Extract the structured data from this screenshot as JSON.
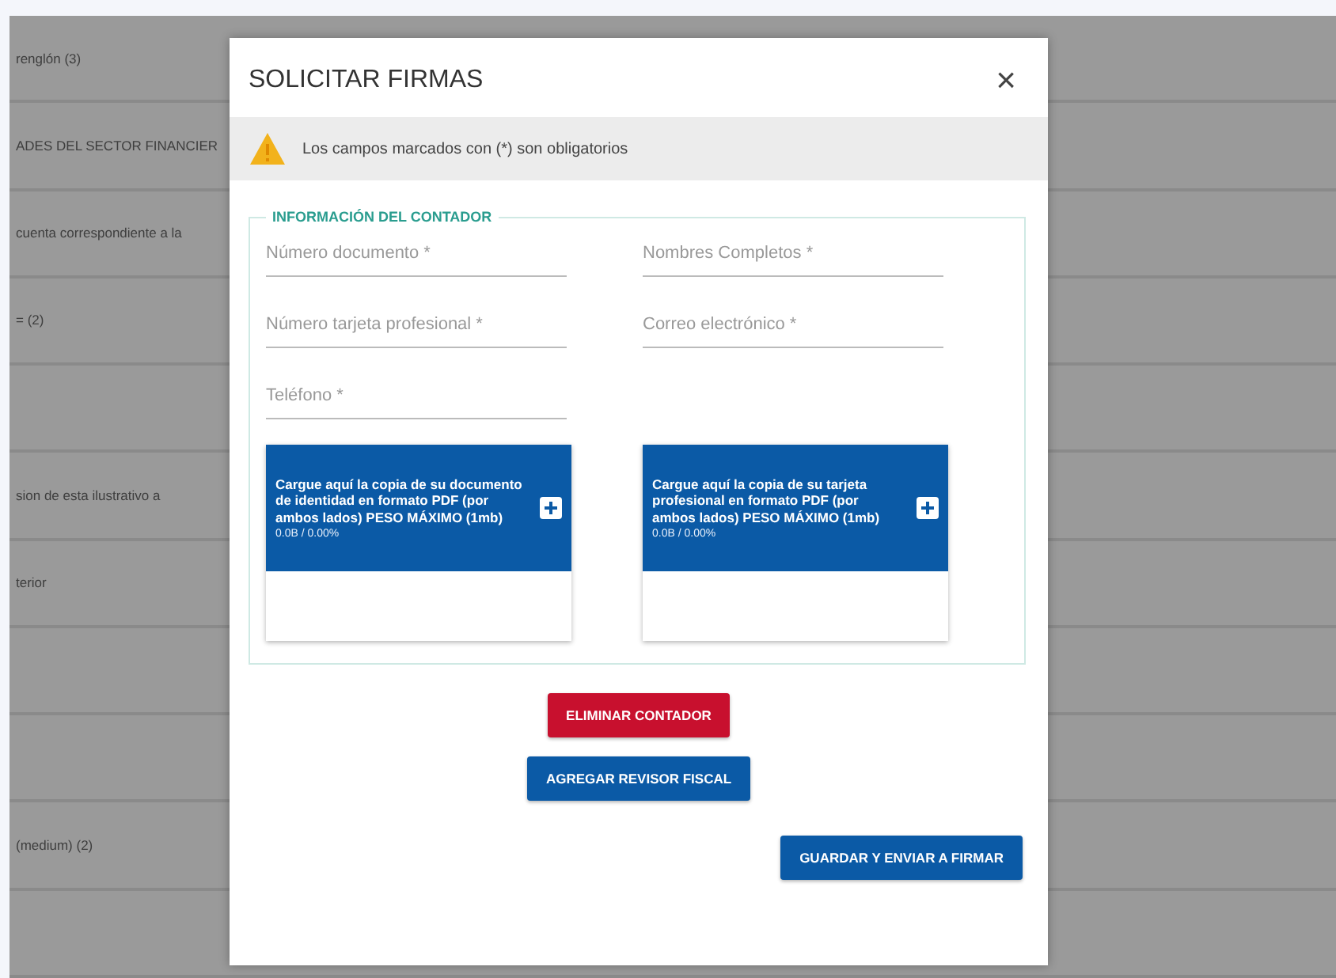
{
  "background_table": {
    "rows": [
      {
        "kind": "text",
        "label": "renglón (3)"
      },
      {
        "kind": "text",
        "label": "ADES DEL SECTOR FINANCIER"
      },
      {
        "kind": "text",
        "label": "cuenta correspondiente a la"
      },
      {
        "kind": "text",
        "label": "= (2)"
      },
      {
        "kind": "empty"
      },
      {
        "kind": "text",
        "label": "sion de esta ilustrativo a"
      },
      {
        "kind": "text",
        "label": "terior"
      },
      {
        "kind": "empty"
      },
      {
        "kind": "empty"
      },
      {
        "kind": "text",
        "label": "(medium) (2)"
      },
      {
        "kind": "empty"
      }
    ]
  },
  "dialog": {
    "title": "SOLICITAR FIRMAS",
    "close": "×",
    "warning": "Los campos marcados con (*) son obligatorios",
    "section": {
      "legend": "INFORMACIÓN DEL CONTADOR",
      "fields": [
        {
          "placeholder": "Número documento *"
        },
        {
          "placeholder": "Nombres Completos *"
        },
        {
          "placeholder": "Número tarjeta profesional *"
        },
        {
          "placeholder": "Correo electrónico *"
        },
        {
          "placeholder": "Teléfono *"
        }
      ],
      "uploads": [
        {
          "text": "Cargue aquí la copia de su documento de identidad en formato PDF (por ambos lados) PESO MÁXIMO (1mb)",
          "progress": "0.0B / 0.00%"
        },
        {
          "text": "Cargue aquí la copia de su tarjeta profesional en formato PDF (por ambos lados) PESO MÁXIMO (1mb)",
          "progress": "0.0B / 0.00%"
        }
      ]
    },
    "buttons": [
      {
        "label": "ELIMINAR CONTADOR",
        "kind": "danger"
      },
      {
        "label": "AGREGAR REVISOR FISCAL",
        "kind": "primary"
      },
      {
        "label": "GUARDAR Y ENVIAR A FIRMAR",
        "kind": "submit"
      }
    ]
  }
}
